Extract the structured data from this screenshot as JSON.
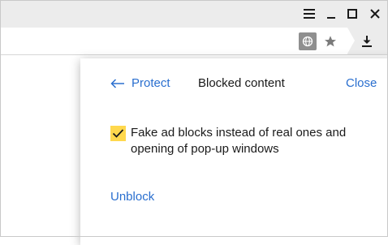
{
  "window": {
    "controls": [
      "menu-icon",
      "minimize-icon",
      "maximize-icon",
      "close-icon"
    ]
  },
  "toolbar": {
    "icons": [
      "globe-icon",
      "star-icon",
      "download-icon"
    ]
  },
  "popup": {
    "back_label": "Protect",
    "title": "Blocked content",
    "close_label": "Close",
    "option": {
      "checked": true,
      "text": "Fake ad blocks instead of real ones and opening of pop-up windows"
    },
    "unblock_label": "Unblock"
  },
  "colors": {
    "accent": "#2a6fcf",
    "checkbox": "#ffd84d",
    "chrome": "#ececec"
  }
}
